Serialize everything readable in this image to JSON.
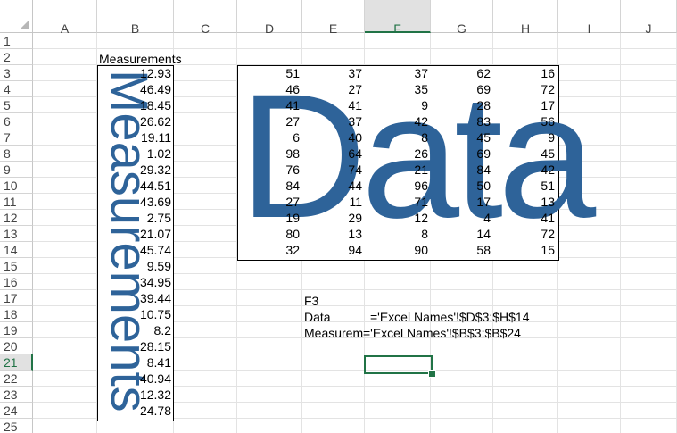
{
  "columns": [
    "A",
    "B",
    "C",
    "D",
    "E",
    "F",
    "G",
    "H",
    "I",
    "J"
  ],
  "rows": [
    "1",
    "2",
    "3",
    "4",
    "5",
    "6",
    "7",
    "8",
    "9",
    "10",
    "11",
    "12",
    "13",
    "14",
    "15",
    "16",
    "17",
    "18",
    "19",
    "20",
    "21",
    "22",
    "23",
    "24",
    "25"
  ],
  "selected_column": "F",
  "selected_row": "21",
  "measurements_header": "Measurements",
  "measurements": [
    "12.93",
    "46.49",
    "18.45",
    "26.62",
    "19.11",
    "1.02",
    "29.32",
    "44.51",
    "43.69",
    "2.75",
    "21.07",
    "45.74",
    "9.59",
    "34.95",
    "39.44",
    "10.75",
    "8.2",
    "28.15",
    "8.41",
    "40.94",
    "12.32",
    "24.78"
  ],
  "data_grid": [
    [
      "51",
      "37",
      "37",
      "62",
      "16"
    ],
    [
      "46",
      "27",
      "35",
      "69",
      "72"
    ],
    [
      "41",
      "41",
      "9",
      "28",
      "17"
    ],
    [
      "27",
      "37",
      "42",
      "83",
      "56"
    ],
    [
      "6",
      "40",
      "8",
      "45",
      "9"
    ],
    [
      "98",
      "64",
      "26",
      "69",
      "45"
    ],
    [
      "76",
      "74",
      "21",
      "84",
      "42"
    ],
    [
      "84",
      "44",
      "96",
      "50",
      "51"
    ],
    [
      "27",
      "11",
      "71",
      "17",
      "13"
    ],
    [
      "19",
      "29",
      "12",
      "4",
      "41"
    ],
    [
      "80",
      "13",
      "8",
      "14",
      "72"
    ],
    [
      "32",
      "94",
      "90",
      "58",
      "15"
    ]
  ],
  "wordart": {
    "data": "Data",
    "measurements": "Measurements",
    "color": "#2e6399"
  },
  "names_info": {
    "ref": "F3",
    "entries": [
      {
        "name": "Data",
        "formula": "='Excel Names'!$D$3:$H$14"
      },
      {
        "name": "Measurem",
        "formula": "='Excel Names'!$B$3:$B$24"
      }
    ]
  },
  "accent_color": "#217346"
}
